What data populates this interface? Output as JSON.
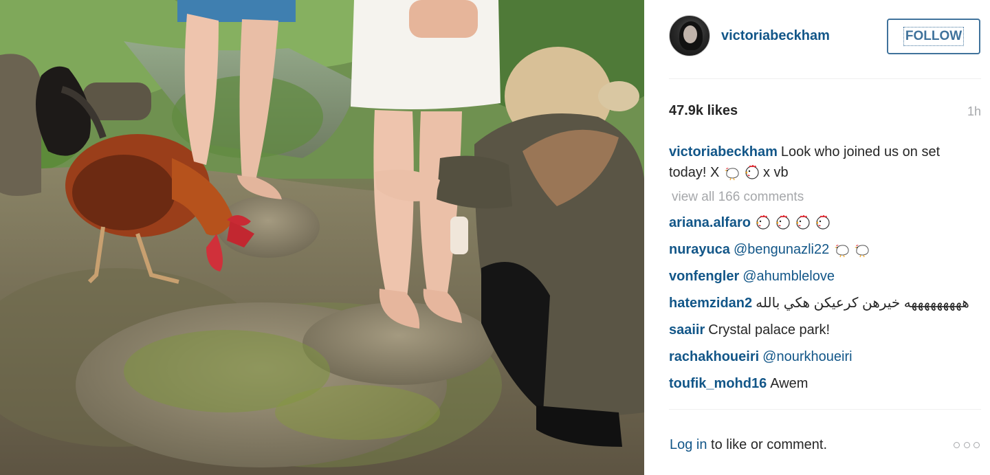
{
  "post": {
    "photo_alt": "",
    "header": {
      "username": "victoriabeckham",
      "follow_label": "FOLLOW"
    },
    "likes": "47.9k likes",
    "time": "1h",
    "caption": {
      "username": "victoriabeckham",
      "text_before": "Look who joined us on set today! X",
      "text_after": "x vb",
      "emojis": [
        "chicken-icon",
        "rooster-icon"
      ]
    },
    "view_all": "view all 166 comments",
    "comments": [
      {
        "user": "ariana.alfaro",
        "text": "",
        "mention": "",
        "emojis": [
          "rooster-icon",
          "rooster-icon",
          "rooster-icon",
          "rooster-icon"
        ]
      },
      {
        "user": "nurayuca",
        "text": "",
        "mention": "@bengunazli22",
        "emojis": [
          "chicken-icon",
          "chicken-icon"
        ]
      },
      {
        "user": "vonfengler",
        "text": "",
        "mention": "@ahumblelove",
        "emojis": []
      },
      {
        "user": "hatemzidan2",
        "text": "هههههههههه خيرهن كرعيكن هكي بالله",
        "mention": "",
        "emojis": []
      },
      {
        "user": "saaiir",
        "text": "Crystal palace park!",
        "mention": "",
        "emojis": []
      },
      {
        "user": "rachakhoueiri",
        "text": "",
        "mention": "@nourkhoueiri",
        "emojis": []
      },
      {
        "user": "toufik_mohd16",
        "text": "Awem",
        "mention": "",
        "emojis": []
      }
    ],
    "footer": {
      "login_link": "Log in",
      "login_rest": " to like or comment.",
      "more_icon": "more-options-icon"
    },
    "colors": {
      "link": "#125688",
      "follow": "#3f729b",
      "muted": "#a5a7aa",
      "text": "#262626",
      "divider": "#efefef"
    }
  }
}
